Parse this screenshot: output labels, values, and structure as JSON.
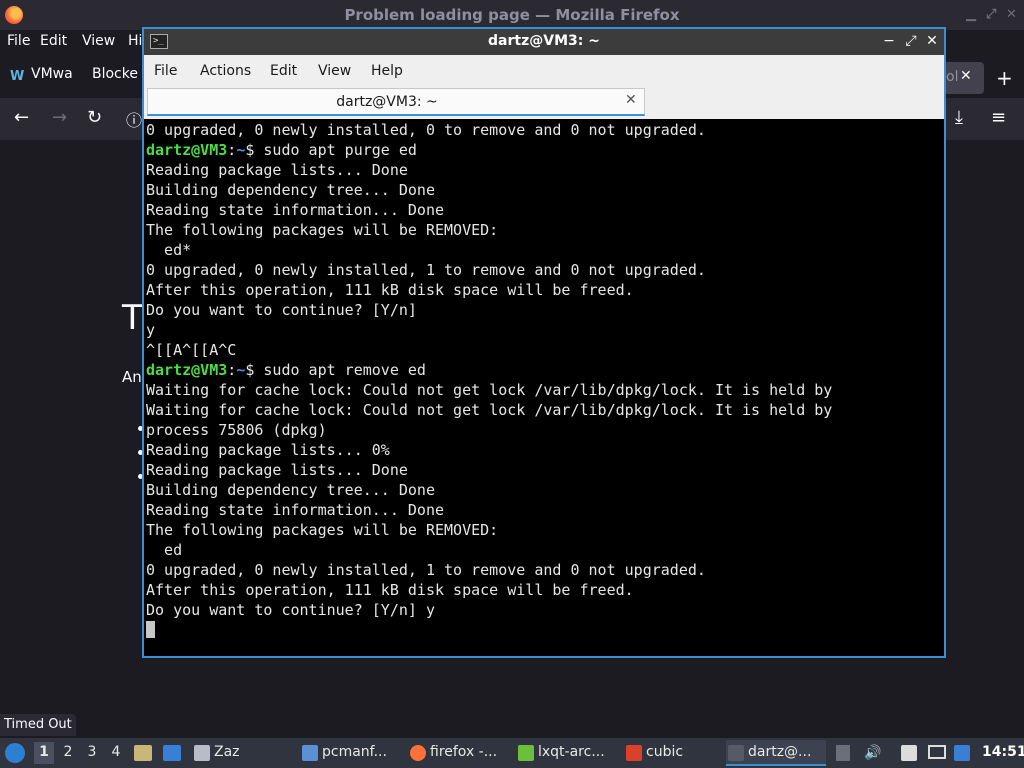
{
  "firefox": {
    "window_title": "Problem loading page — Mozilla Firefox",
    "menu": [
      "File",
      "Edit",
      "View",
      "Hi"
    ],
    "tabs": [
      "VMwa",
      "Blocke"
    ],
    "tab_right_partial": "ol",
    "error_title_partial": "T",
    "error_text_partial": "An",
    "tooltip": "Timed Out"
  },
  "terminal": {
    "window_title": "dartz@VM3: ~",
    "menu": [
      "File",
      "Actions",
      "Edit",
      "View",
      "Help"
    ],
    "tab_label": "dartz@VM3: ~",
    "prompt_user": "dartz@VM3",
    "prompt_path": "~",
    "lines": [
      {
        "text": "0 upgraded, 0 newly installed, 0 to remove and 0 not upgraded."
      },
      {
        "prompt": true,
        "cmd": "$ sudo apt purge ed"
      },
      {
        "text": "Reading package lists... Done"
      },
      {
        "text": "Building dependency tree... Done"
      },
      {
        "text": "Reading state information... Done"
      },
      {
        "text": "The following packages will be REMOVED:"
      },
      {
        "text": "  ed*"
      },
      {
        "text": "0 upgraded, 0 newly installed, 1 to remove and 0 not upgraded."
      },
      {
        "text": "After this operation, 111 kB disk space will be freed."
      },
      {
        "text": "Do you want to continue? [Y/n]"
      },
      {
        "text": "y"
      },
      {
        "text": "^[[A^[[A^C"
      },
      {
        "prompt": true,
        "cmd": "$ sudo apt remove ed"
      },
      {
        "text": "Waiting for cache lock: Could not get lock /var/lib/dpkg/lock. It is held by"
      },
      {
        "text": "Waiting for cache lock: Could not get lock /var/lib/dpkg/lock. It is held by"
      },
      {
        "text": "process 75806 (dpkg)"
      },
      {
        "text": "Reading package lists... 0%"
      },
      {
        "text": "Reading package lists... Done"
      },
      {
        "text": "Building dependency tree... Done"
      },
      {
        "text": "Reading state information... Done"
      },
      {
        "text": "The following packages will be REMOVED:"
      },
      {
        "text": "  ed"
      },
      {
        "text": "0 upgraded, 0 newly installed, 1 to remove and 0 not upgraded."
      },
      {
        "text": "After this operation, 111 kB disk space will be freed."
      },
      {
        "text": "Do you want to continue? [Y/n] y"
      },
      {
        "cursor": true
      }
    ]
  },
  "taskbar": {
    "workspaces": [
      "1",
      "2",
      "3",
      "4"
    ],
    "tasks": [
      {
        "label": "Zaz",
        "icon": "window-icon",
        "color": "#b8bcc8"
      },
      {
        "label": "pcmanf...",
        "icon": "folder-icon",
        "color": "#5b8fd6"
      },
      {
        "label": "firefox -...",
        "icon": "firefox-icon",
        "color": "#ff7139"
      },
      {
        "label": "lxqt-arc...",
        "icon": "archive-icon",
        "color": "#6bbf3a"
      },
      {
        "label": "cubic",
        "icon": "cubic-icon",
        "color": "#d9412b"
      },
      {
        "label": "dartz@...",
        "icon": "terminal-icon",
        "color": "#555a66"
      }
    ],
    "clock": "14:51"
  }
}
